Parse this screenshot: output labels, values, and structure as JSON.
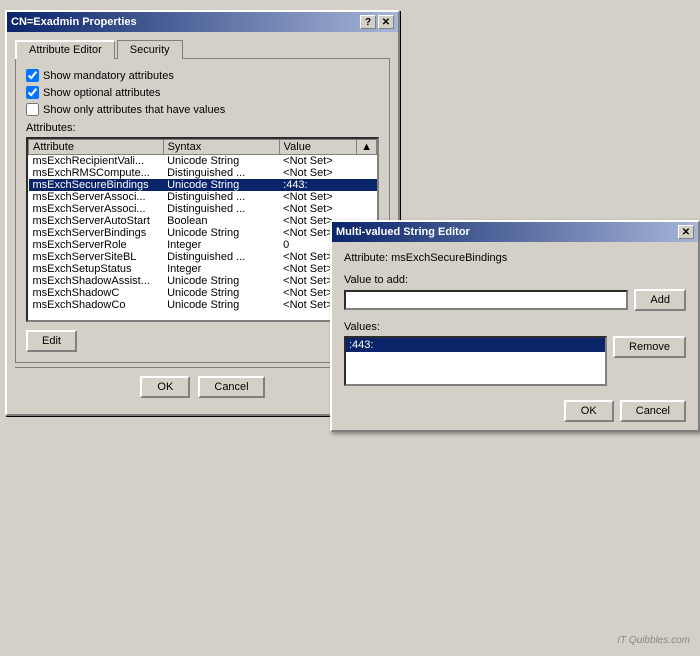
{
  "mainDialog": {
    "title": "CN=Exadmin Properties",
    "helpBtn": "?",
    "closeBtn": "✕",
    "tabs": [
      {
        "label": "Attribute Editor",
        "active": true
      },
      {
        "label": "Security",
        "active": false
      }
    ],
    "checkboxes": [
      {
        "label": "Show mandatory attributes",
        "checked": true,
        "id": "cb1"
      },
      {
        "label": "Show optional attributes",
        "checked": true,
        "id": "cb2"
      },
      {
        "label": "Show only attributes that have values",
        "checked": false,
        "id": "cb3"
      }
    ],
    "attributesLabel": "Attributes:",
    "tableHeaders": [
      "Attribute",
      "Syntax",
      "Value"
    ],
    "tableRows": [
      {
        "attribute": "msExchRecipientVali...",
        "syntax": "Unicode String",
        "value": "<Not Set>",
        "selected": false
      },
      {
        "attribute": "msExchRMSCompute...",
        "syntax": "Distinguished ...",
        "value": "<Not Set>",
        "selected": false
      },
      {
        "attribute": "msExchSecureBindings",
        "syntax": "Unicode String",
        "value": ":443:",
        "selected": true
      },
      {
        "attribute": "msExchServerAssoci...",
        "syntax": "Distinguished ...",
        "value": "<Not Set>",
        "selected": false
      },
      {
        "attribute": "msExchServerAssoci...",
        "syntax": "Distinguished ...",
        "value": "<Not Set>",
        "selected": false
      },
      {
        "attribute": "msExchServerAutoStart",
        "syntax": "Boolean",
        "value": "<Not Set>",
        "selected": false
      },
      {
        "attribute": "msExchServerBindings",
        "syntax": "Unicode String",
        "value": "<Not Set>",
        "selected": false
      },
      {
        "attribute": "msExchServerRole",
        "syntax": "Integer",
        "value": "0",
        "selected": false
      },
      {
        "attribute": "msExchServerSiteBL",
        "syntax": "Distinguished ...",
        "value": "<Not Set>",
        "selected": false
      },
      {
        "attribute": "msExchSetupStatus",
        "syntax": "Integer",
        "value": "<Not Set>",
        "selected": false
      },
      {
        "attribute": "msExchShadowAssist...",
        "syntax": "Unicode String",
        "value": "<Not Set>",
        "selected": false
      },
      {
        "attribute": "msExchShadowC",
        "syntax": "Unicode String",
        "value": "<Not Set>",
        "selected": false
      },
      {
        "attribute": "msExchShadowCo",
        "syntax": "Unicode String",
        "value": "<Not Set>",
        "selected": false
      }
    ],
    "editBtn": "Edit",
    "okBtn": "OK",
    "cancelBtn": "Cancel"
  },
  "mvseDialog": {
    "title": "Multi-valued String Editor",
    "closeBtn": "✕",
    "attributeLabel": "Attribute:",
    "attributeValue": "msExchSecureBindings",
    "valueToAddLabel": "Value to add:",
    "addBtn": "Add",
    "valuesLabel": "Values:",
    "listItems": [
      ":443:"
    ],
    "selectedItem": ":443:",
    "removeBtn": "Remove",
    "okBtn": "OK",
    "cancelBtn": "Cancel"
  },
  "watermark": "IT Quibbles.com"
}
